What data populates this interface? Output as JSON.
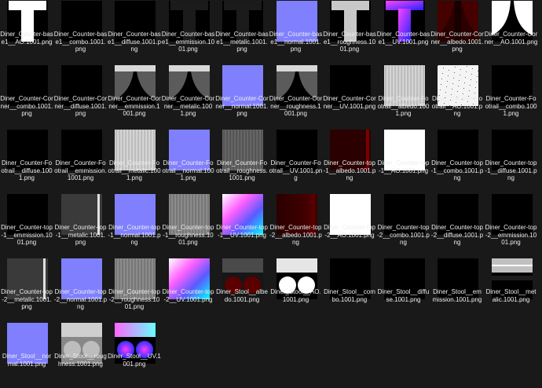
{
  "files": [
    "Diner_Counter-base1__AO.1001.png",
    "Diner_Counter-base1__combo.1001.png",
    "Diner_Counter-base1__diffuse.1001.png",
    "Diner_Counter-base1__emmission.1001.png",
    "Diner_Counter-base1__metalic.1001.png",
    "Diner_Counter-base1__normal.1001.png",
    "Diner_Counter-base1__roughness.1001.png",
    "Diner_Counter-base1__UV.1001.png",
    "Diner_Counter-Corner__albedo.1001.png",
    "Diner_Counter-Corner__AO.1001.png",
    "Diner_Counter-Corner__combo.1001.png",
    "Diner_Counter-Corner__diffuse.1001.png",
    "Diner_Counter-Corner__emmission.1001.png",
    "Diner_Counter-Corner__metalic.1001.png",
    "Diner_Counter-Corner__normal.1001.png",
    "Diner_Counter-Corner__roughness.1001.png",
    "Diner_Counter-Corner__UV.1001.png",
    "Diner_Counter-Footrail__albedo.1001.png",
    "Diner_Counter-Footrail__AO.1001.png",
    "Diner_Counter-Footrail__combo.1001.png",
    "Diner_Counter-Footrail__diffuse.1001.png",
    "Diner_Counter-Footrail__emmission.1001.png",
    "Diner_Counter-Footrail__metalic.1001.png",
    "Diner_Counter-Footrail__normal.1001.png",
    "Diner_Counter-Footrail__roughness.1001.png",
    "Diner_Counter-Footrail__UV.1001.png",
    "Diner_Counter-top-1__albedo.1001.png",
    "Diner_Counter-top-1__AO.1001.png",
    "Diner_Counter-top-1__combo.1001.png",
    "Diner_Counter-top-1__diffuse.1001.png",
    "Diner_Counter-top-1__emmission.1001.png",
    "Diner_Counter-top-1__metalic.1001.png",
    "Diner_Counter-top-1__normal.1001.png",
    "Diner_Counter-top-1__roughness.1001.png",
    "Diner_Counter-top-1__UV.1001.png",
    "Diner_Counter-top-2__albedo.1001.png",
    "Diner_Counter-top-2__AO.1001.png",
    "Diner_Counter-top-2__combo.1001.png",
    "Diner_Counter-top-2__diffuse.1001.png",
    "Diner_Counter-top-2__emmission.1001.png",
    "Diner_Counter-top-2__metalic.1001.png",
    "Diner_Counter-top-2__normal.1001.png",
    "Diner_Counter-top-2__roughness.1001.png",
    "Diner_Counter-top-2__UV.1001.png",
    "Diner_Stool__albedo.1001.png",
    "Diner_Stool__AO.1001.png",
    "Diner_Stool__combo.1001.png",
    "Diner_Stool__diffuse.1001.png",
    "Diner_Stool__emmission.1001.png",
    "Diner_Stool__metalic.1001.png",
    "Diner_Stool__normal.1001.png",
    "Diner_Stool__roughness.1001.png",
    "Diner_Stool__UV.1001.png"
  ],
  "thumbs": [
    "t-white",
    "black",
    "black",
    "t-dark",
    "t-dark",
    "normal",
    "t-gray",
    "t-uv",
    "corner-red",
    "corner-white",
    "black",
    "black",
    "corner-gray",
    "corner-gray",
    "normal",
    "corner-gray",
    "black",
    "grain-lite",
    "speckle",
    "black",
    "black",
    "black",
    "grain",
    "normal",
    "grain-dark",
    "black",
    "redstrip",
    "white",
    "black",
    "black",
    "black",
    "gray-strip",
    "normal",
    "grain-mid",
    "uvfull",
    "albedo-red",
    "white",
    "black",
    "black",
    "black",
    "gray-strip",
    "normal",
    "grain-mid",
    "uvfull",
    "stool-red",
    "stool-white",
    "black",
    "black",
    "black",
    "stool-gray",
    "normal",
    "stool-lgray",
    "stool-uv"
  ],
  "colors": {
    "background": "#191919",
    "normal_map": "#8080ff",
    "label_text": "#ededed"
  }
}
